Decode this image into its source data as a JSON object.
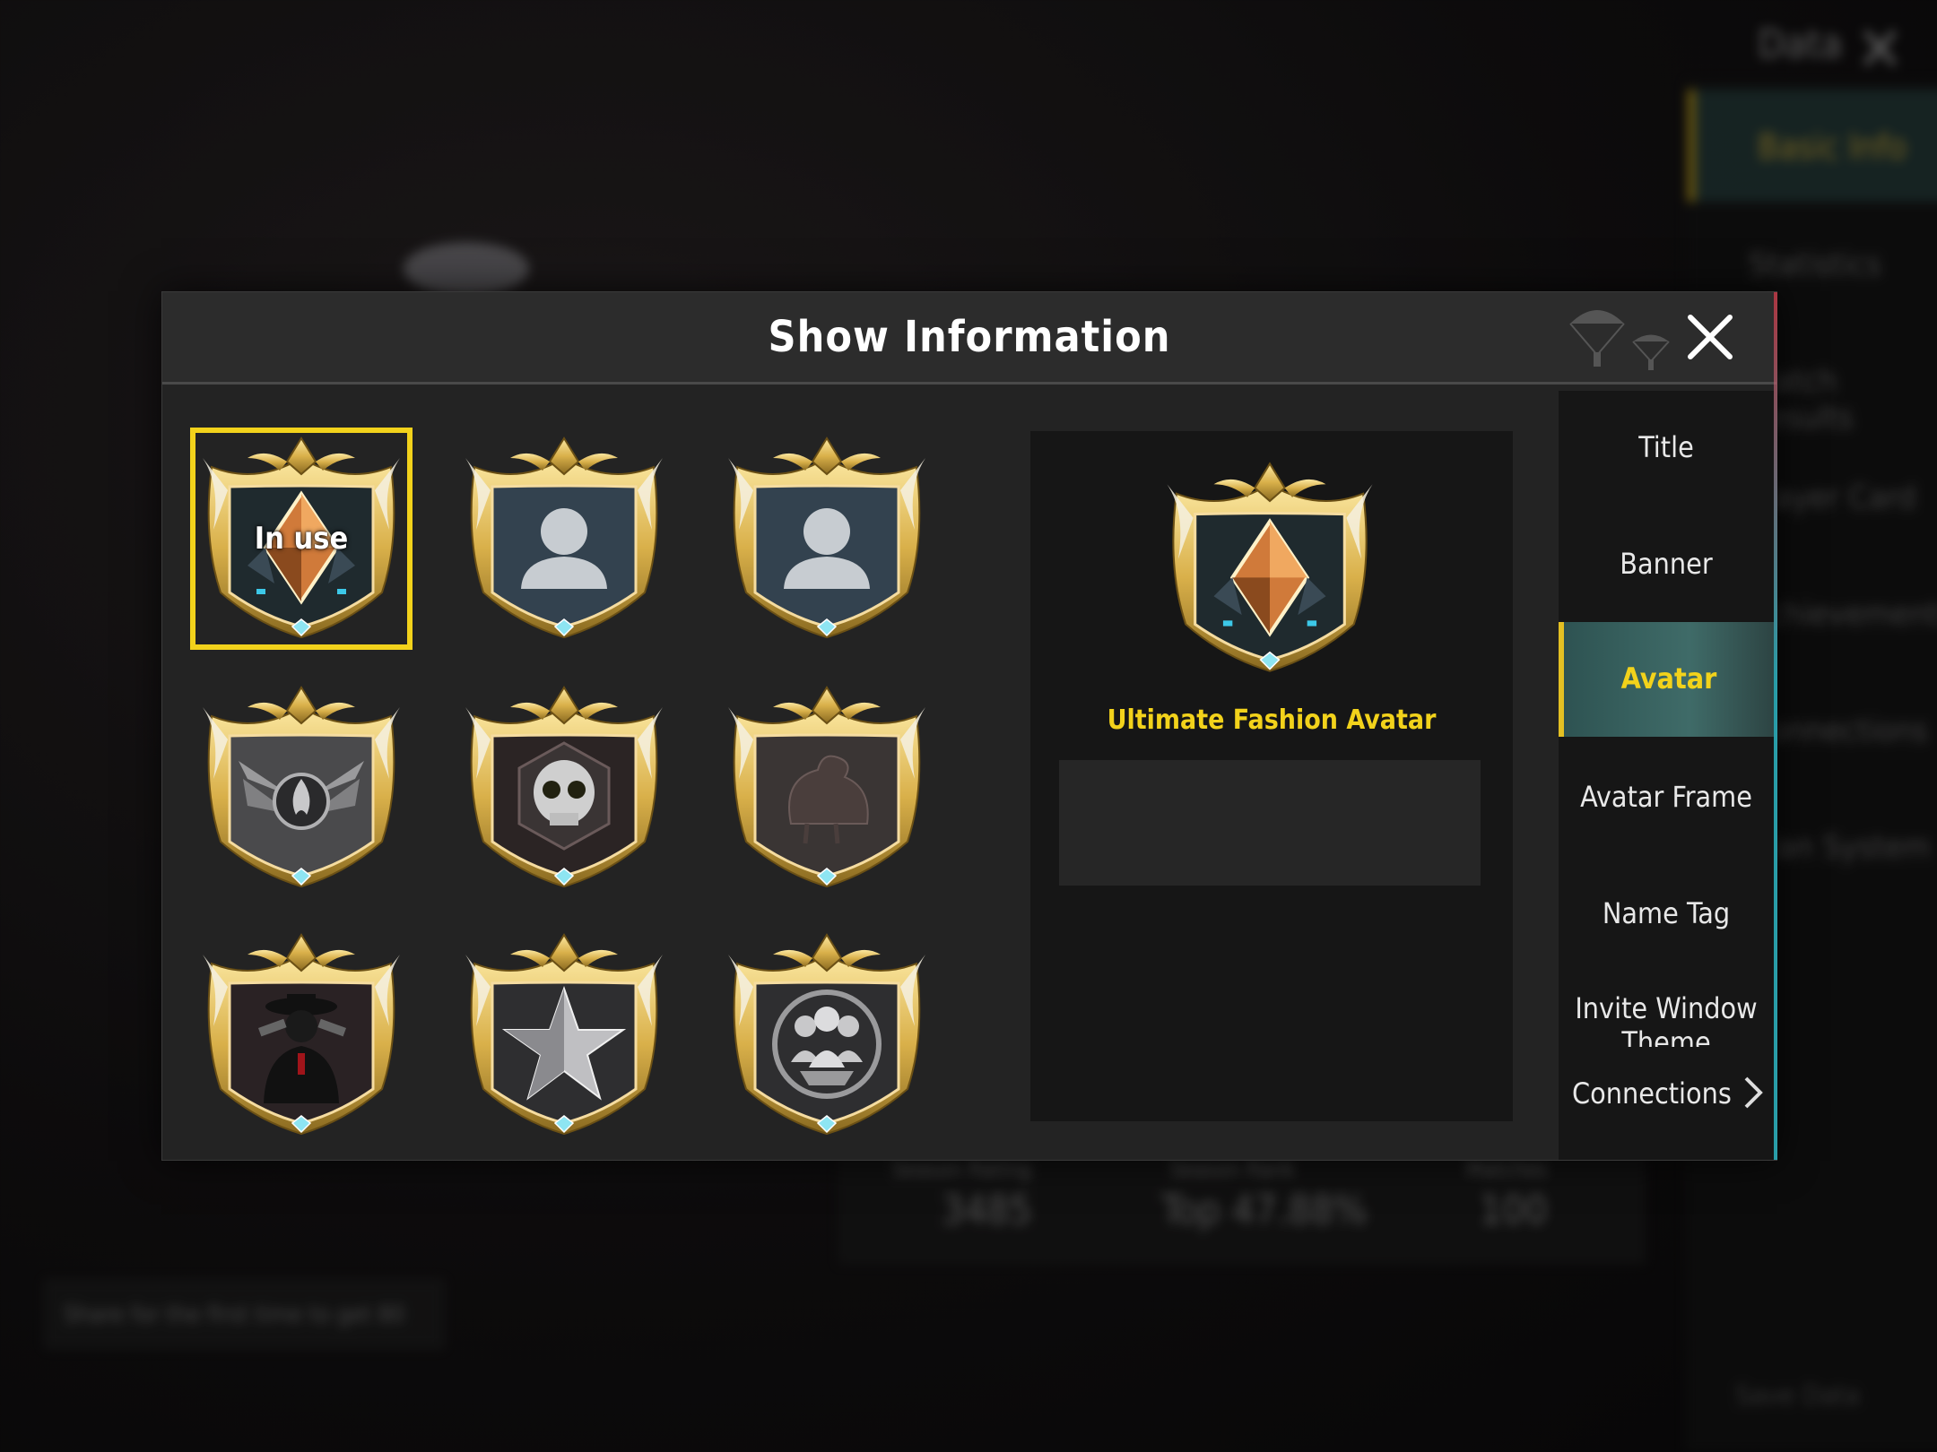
{
  "background": {
    "title": "Data",
    "basic_info_tab": "Basic Info",
    "right_items": [
      "Statistics",
      "Match Results",
      "Player Card",
      "Achievements",
      "Connections",
      "Clan System"
    ],
    "stats": [
      {
        "label": "Season Rating",
        "value": "3485"
      },
      {
        "label": "Season Rank",
        "value": "Top 47.88%"
      },
      {
        "label": "Matches",
        "value": "100"
      }
    ],
    "share_text": "Share for the first time to get 80",
    "save_text": "Save Data"
  },
  "modal": {
    "title": "Show Information",
    "avatars": [
      {
        "name": "ultimate-fashion-avatar",
        "emblem": "diamond",
        "selected": true,
        "in_use_label": "In use"
      },
      {
        "name": "default-avatar-1",
        "emblem": "person"
      },
      {
        "name": "default-avatar-2",
        "emblem": "person"
      },
      {
        "name": "winged-flame-avatar",
        "emblem": "flame"
      },
      {
        "name": "skull-avatar",
        "emblem": "skull"
      },
      {
        "name": "chicken-avatar",
        "emblem": "chicken"
      },
      {
        "name": "gunman-avatar",
        "emblem": "gunman"
      },
      {
        "name": "star-avatar",
        "emblem": "star"
      },
      {
        "name": "squad-avatar",
        "emblem": "squad"
      }
    ],
    "preview": {
      "name": "Ultimate Fashion Avatar",
      "description": ""
    },
    "tabs": [
      {
        "label": "Title",
        "active": false
      },
      {
        "label": "Banner",
        "active": false
      },
      {
        "label": "Avatar",
        "active": true
      },
      {
        "label": "Avatar Frame",
        "active": false
      },
      {
        "label": "Name Tag",
        "active": false
      },
      {
        "label": "Invite Window Theme",
        "active": false
      }
    ],
    "connections_label": "Connections",
    "colors": {
      "accent": "#f2d21b",
      "active_tab": "#3f6b68",
      "gold_frame": "#d9b04a"
    }
  }
}
